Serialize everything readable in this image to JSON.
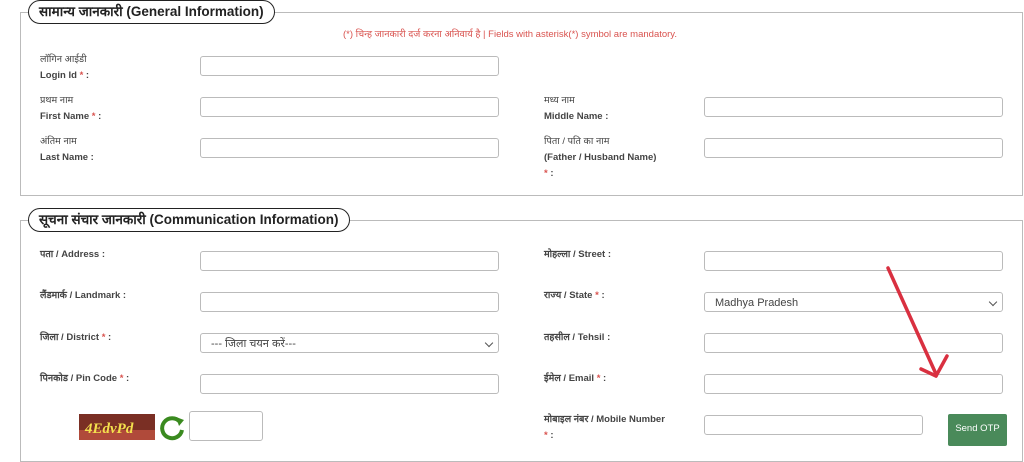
{
  "general": {
    "legend": "सामान्य जानकारी (General Information)",
    "mandatory_note": "(*) चिन्ह जानकारी दर्ज करना अनिवार्य है | Fields with asterisk(*) symbol are mandatory.",
    "login_hi": "लॉगिन आईडी",
    "login_en": "Login Id",
    "first_hi": "प्रथम नाम",
    "first_en": "First Name",
    "middle_hi": "मध्य नाम",
    "middle_en": "Middle Name :",
    "last_hi": "अंतिम नाम",
    "last_en": "Last Name :",
    "father_hi": "पिता / पति का नाम",
    "father_en": "(Father / Husband Name)",
    "star": "*",
    "colon": ":"
  },
  "communication": {
    "legend": "सूचना संचार जानकारी (Communication Information)",
    "address": "पता / Address :",
    "street": "मोहल्ला / Street :",
    "landmark": "लैंडमार्क / Landmark :",
    "state": "राज्य / State",
    "state_value": "Madhya Pradesh",
    "district": "जिला / District",
    "district_value": "--- जिला चयन करें---",
    "tehsil": "तहसील / Tehsil :",
    "pincode": "पिनकोड / Pin Code",
    "email": "ईमेल / Email",
    "mobile": "मोबाइल नंबर / Mobile Number",
    "captcha_text": "4EdvPd",
    "send_otp": "Send OTP"
  },
  "colors": {
    "accent": "#4a8a5a",
    "required": "#d9534f",
    "arrow": "#d93040"
  }
}
